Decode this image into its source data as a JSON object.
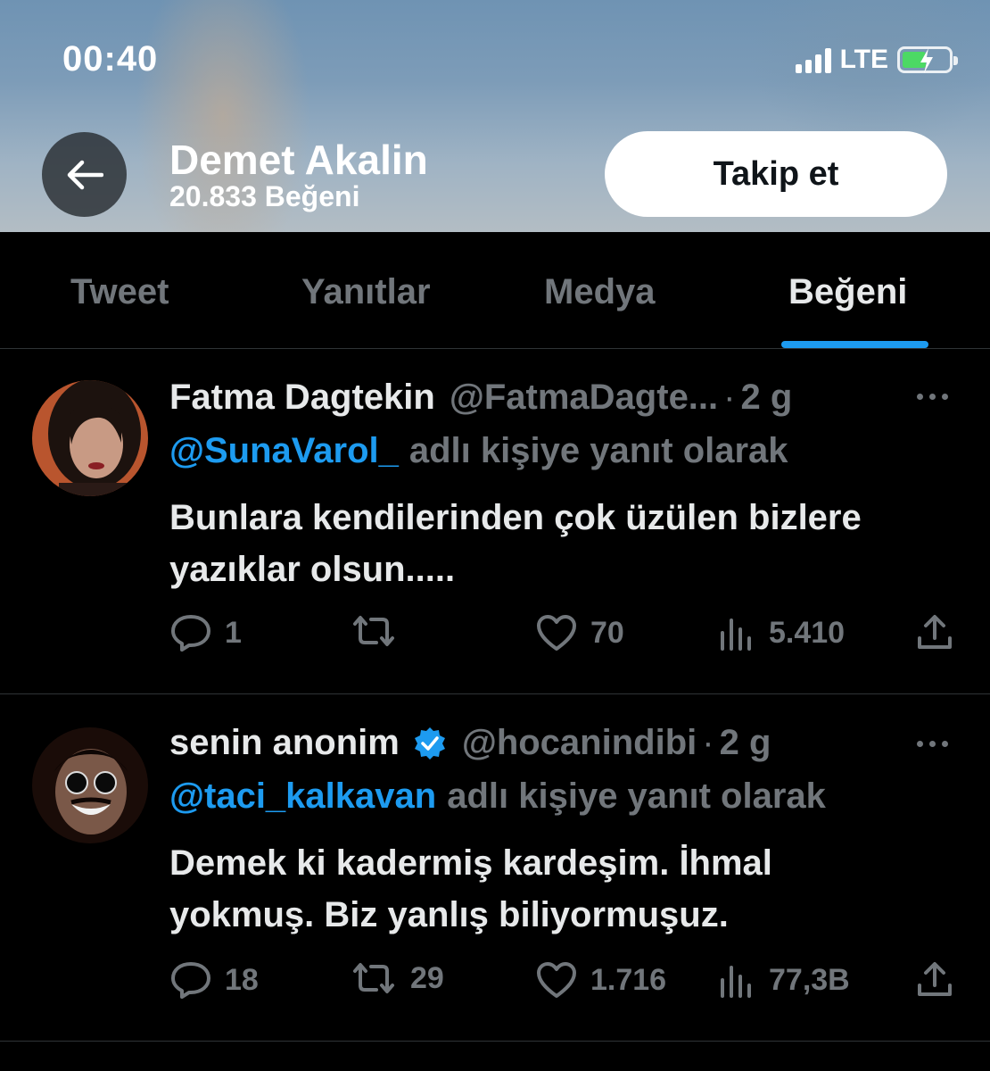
{
  "status_bar": {
    "time": "00:40",
    "network": "LTE"
  },
  "profile": {
    "name": "Demet Akalin",
    "likes_count": "20.833 Beğeni",
    "follow_label": "Takip et"
  },
  "tabs": [
    {
      "label": "Tweet",
      "active": false
    },
    {
      "label": "Yanıtlar",
      "active": false
    },
    {
      "label": "Medya",
      "active": false
    },
    {
      "label": "Beğeni",
      "active": true
    }
  ],
  "tweets": [
    {
      "name": "Fatma Dagtekin",
      "handle": "@FatmaDagte...",
      "separator": "·",
      "time": "2 g",
      "verified": false,
      "reply_mention": "@SunaVarol_",
      "reply_rest": "adlı kişiye yanıt olarak",
      "text_line1": "Bunlara kendilerinden çok üzülen bizlere",
      "text_line2": "yazıklar olsun.....",
      "replies": "1",
      "retweets": "",
      "likes": "70",
      "views": "5.410"
    },
    {
      "name": "senin anonim",
      "handle": "@hocanindibi",
      "separator": "·",
      "time": "2 g",
      "verified": true,
      "reply_mention": "@taci_kalkavan",
      "reply_rest": "adlı kişiye yanıt olarak",
      "text_line1": "Demek ki kadermiş kardeşim. İhmal",
      "text_line2": "yokmuş. Biz yanlış biliyormuşuz.",
      "replies": "18",
      "retweets": "29",
      "likes": "1.716",
      "views": "77,3B"
    }
  ],
  "colors": {
    "background": "#000000",
    "accent": "#1d9bf0",
    "muted": "#71767b",
    "text": "#e7e9ea",
    "battery": "#4cd964"
  }
}
